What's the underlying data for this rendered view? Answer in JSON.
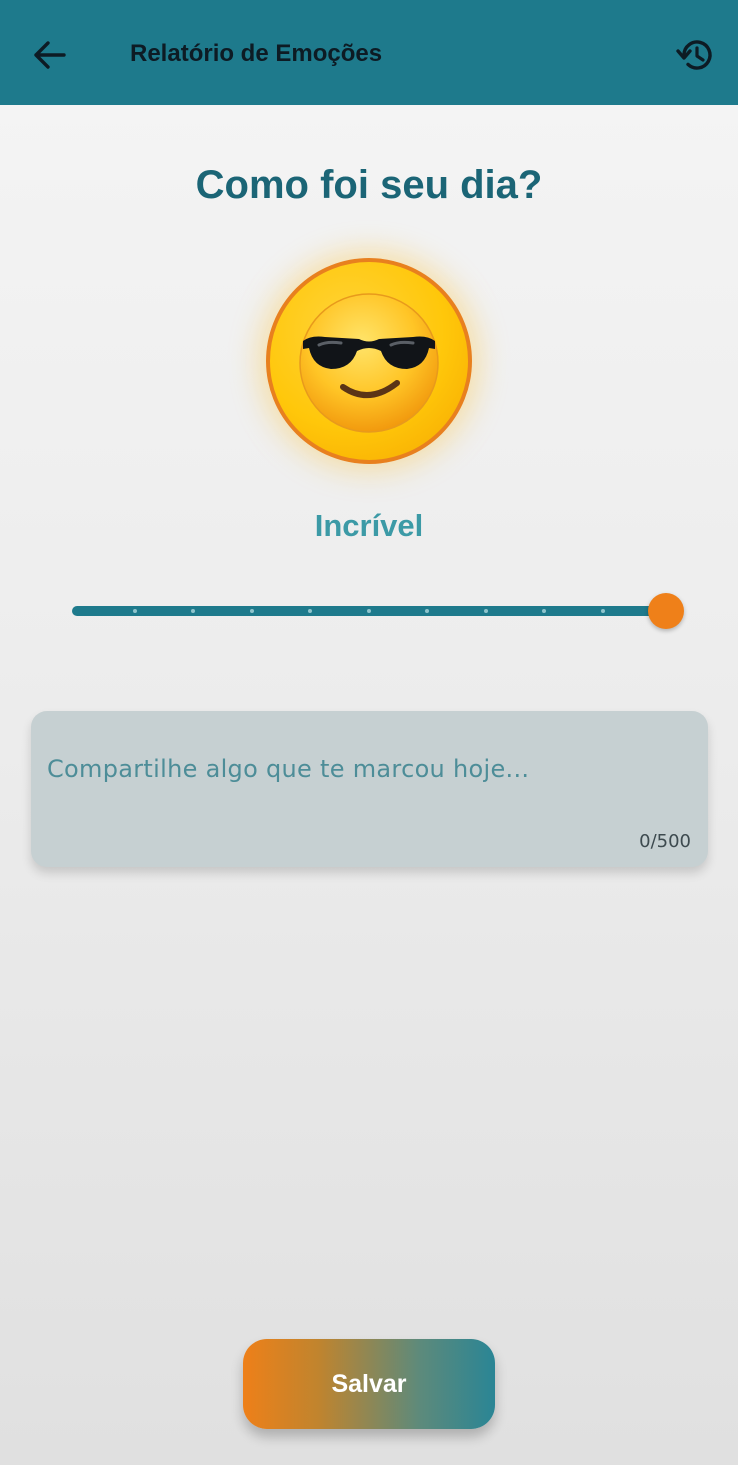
{
  "app_bar": {
    "title": "Relatório de Emoções",
    "back_icon": "arrow-left-icon",
    "history_icon": "history-icon",
    "color": "#1e7a8c"
  },
  "main": {
    "question": "Como foi seu dia?",
    "mood": {
      "emoji": "smiling-face-with-sunglasses",
      "label": "Incrível"
    },
    "slider": {
      "value": 10,
      "min": 0,
      "max": 10,
      "thumb_color": "#ef8019",
      "track_color": "#1e7a8c"
    },
    "note": {
      "placeholder": "Compartilhe algo que te marcou hoje...",
      "value": "",
      "counter": "0/500"
    }
  },
  "actions": {
    "save_label": "Salvar"
  },
  "colors": {
    "primary": "#1e7a8c",
    "accent": "#ef8019",
    "heading": "#1b6576",
    "mood_label": "#3c9aa6"
  }
}
